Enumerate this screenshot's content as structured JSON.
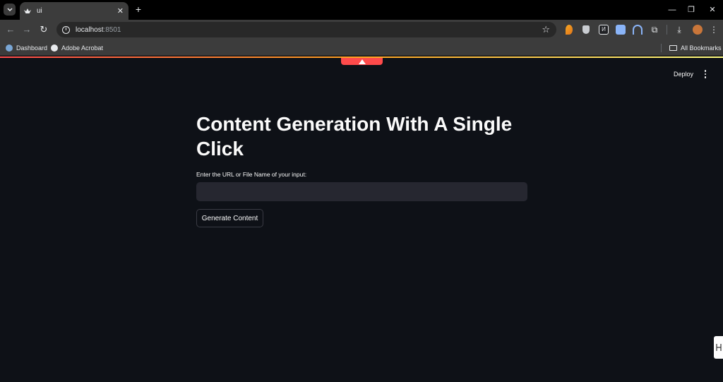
{
  "browser": {
    "tab_title": "ui",
    "tab_close": "✕",
    "new_tab": "+",
    "url_host": "localhost",
    "url_port": ":8501",
    "bookmarks": [
      {
        "label": "Dashboard",
        "icon": "dashboard-icon",
        "color": "#7aa7d6"
      },
      {
        "label": "Adobe Acrobat",
        "icon": "globe-icon",
        "color": "#e8eaed"
      }
    ],
    "all_bookmarks": "All Bookmarks",
    "minimize": "—",
    "restore": "❐",
    "close": "✕"
  },
  "app": {
    "deploy_label": "Deploy",
    "title": "Content Generation With A Single Click",
    "input_label": "Enter the URL or File Name of your input:",
    "input_value": "",
    "button_label": "Generate Content",
    "accent": "#ff4b4b",
    "background": "#0e1117"
  }
}
